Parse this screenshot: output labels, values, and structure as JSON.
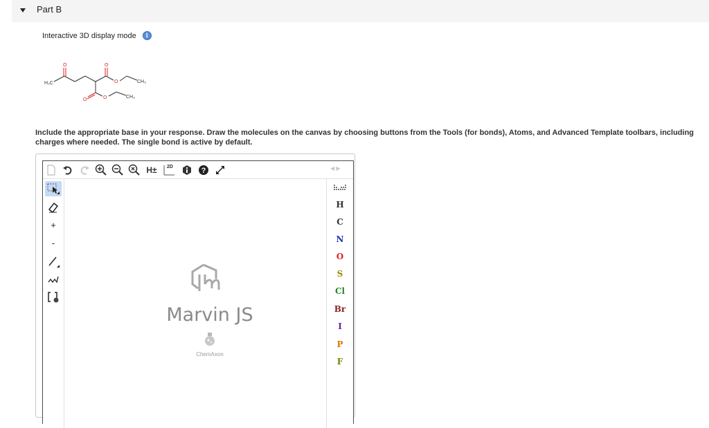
{
  "part": {
    "title": "Part B"
  },
  "display_mode": {
    "label": "Interactive 3D display mode"
  },
  "molecule": {
    "labels": {
      "h3c": "H₃C",
      "o_ketone": "O",
      "o_ester1_carbonyl": "O",
      "o_ester1_link": "O",
      "ch3_1": "CH₃",
      "o_ester2_carbonyl": "O",
      "o_ester2_link": "O",
      "ch3_2": "CH₃"
    }
  },
  "instructions": "Include the appropriate base in your response. Draw the molecules on the canvas by choosing buttons from the Tools (for bonds), Atoms, and Advanced Template toolbars, including charges where needed. The single bond is active by default.",
  "editor": {
    "top_toolbar": {
      "h_toggle_label": "H±",
      "clean_2d_label": "2D"
    },
    "left_toolbar": {
      "plus_label": "+",
      "minus_label": "-"
    },
    "atoms": [
      {
        "symbol": "H",
        "color": "#333333"
      },
      {
        "symbol": "C",
        "color": "#333333"
      },
      {
        "symbol": "N",
        "color": "#2233bb"
      },
      {
        "symbol": "O",
        "color": "#dd2222"
      },
      {
        "symbol": "S",
        "color": "#998800"
      },
      {
        "symbol": "Cl",
        "color": "#228822"
      },
      {
        "symbol": "Br",
        "color": "#882222"
      },
      {
        "symbol": "I",
        "color": "#6622aa"
      },
      {
        "symbol": "P",
        "color": "#dd7700"
      },
      {
        "symbol": "F",
        "color": "#668800"
      }
    ],
    "watermark": {
      "title": "Marvin JS",
      "subtitle": "ChemAxon"
    }
  },
  "colors": {
    "info_blue": "#5b8fd6",
    "active_tool": "#c5daf5",
    "oxygen_red": "#dd2222"
  }
}
